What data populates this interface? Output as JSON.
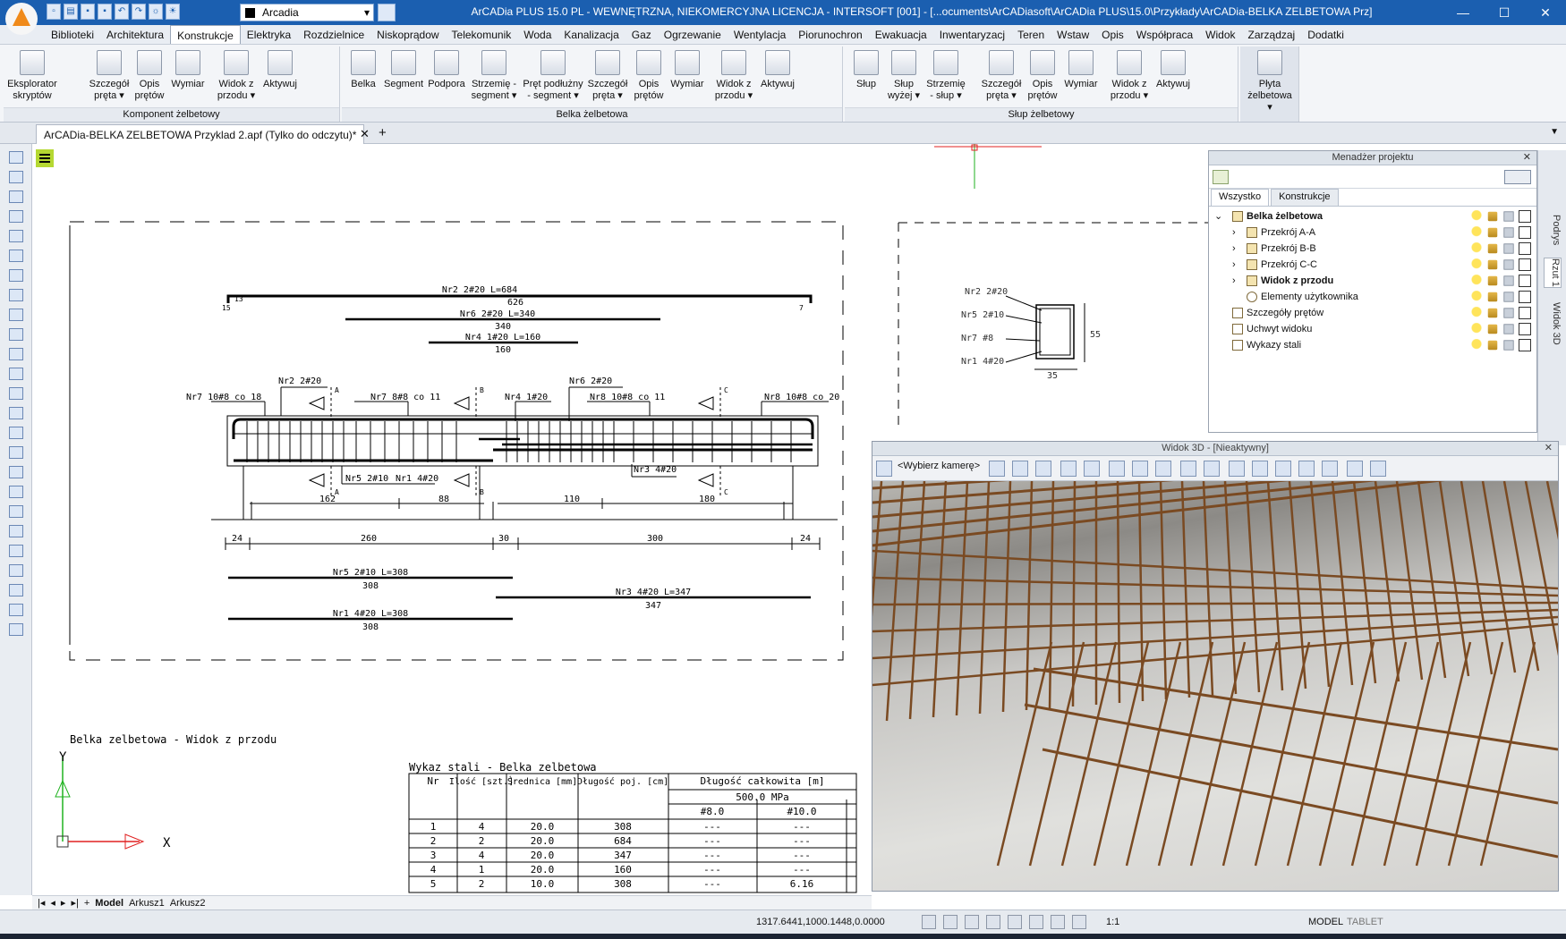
{
  "window": {
    "title": "ArCADia PLUS 15.0 PL - WEWNĘTRZNA, NIEKOMERCYJNA LICENCJA - INTERSOFT [001] - [...ocuments\\ArCADiasoft\\ArCADia PLUS\\15.0\\Przykłady\\ArCADia-BELKA ZELBETOWA Prz]",
    "layer": "Arcadia",
    "minimize": "—",
    "maximize": "☐",
    "close": "✕"
  },
  "menu": [
    "Biblioteki",
    "Architektura",
    "Konstrukcje",
    "Elektryka",
    "Rozdzielnice",
    "Niskoprądow",
    "Telekomunik",
    "Woda",
    "Kanalizacja",
    "Gaz",
    "Ogrzewanie",
    "Wentylacja",
    "Piorunochron",
    "Ewakuacja",
    "Inwentaryzacj",
    "Teren",
    "Wstaw",
    "Opis",
    "Współpraca",
    "Widok",
    "Zarządzaj",
    "Dodatki"
  ],
  "ribbon": {
    "g1": {
      "label": "Komponent żelbetowy",
      "b1": "Eksplorator skryptów",
      "b2": "Szczegół pręta ▾",
      "b3": "Opis prętów",
      "b4": "Wymiar",
      "b5": "Widok z przodu ▾",
      "b6": "Aktywuj"
    },
    "g2": {
      "label": "Belka żelbetowa",
      "b1": "Belka",
      "b2": "Segment",
      "b3": "Podpora",
      "b4": "Strzemię - segment ▾",
      "b5": "Pręt podłużny - segment ▾",
      "b6": "Szczegół pręta ▾",
      "b7": "Opis prętów",
      "b8": "Wymiar",
      "b9": "Widok z przodu ▾",
      "b10": "Aktywuj"
    },
    "g3": {
      "label": "Słup żelbetowy",
      "b1": "Słup",
      "b2": "Słup wyżej ▾",
      "b3": "Strzemię - słup ▾",
      "b4": "Szczegół pręta ▾",
      "b5": "Opis prętów",
      "b6": "Wymiar",
      "b7": "Widok z przodu ▾",
      "b8": "Aktywuj"
    },
    "g4": {
      "b1": "Płyta żelbetowa ▾"
    }
  },
  "doc": {
    "tab": "ArCADia-BELKA ZELBETOWA Przyklad 2.apf (Tylko do odczytu)*",
    "close": "✕",
    "plus": "+"
  },
  "drawing": {
    "t1a": "Nr2 2#20 L=684",
    "t1b": "626",
    "t2a": "Nr6 2#20 L=340",
    "t2b": "340",
    "t3a": "Nr4 1#20 L=160",
    "t3b": "160",
    "l1": "Nr7 10#8 co 18",
    "l2": "Nr2 2#20",
    "l3": "Nr7 8#8 co 11",
    "l4": "Nr4 1#20",
    "l5": "Nr6 2#20",
    "l6": "Nr8 10#8 co 11",
    "l7": "Nr8 10#8 co 20",
    "l8": "Nr5 2#10",
    "l9": "Nr1 4#20",
    "l10": "Nr3 4#20",
    "d1": "162",
    "d2": "88",
    "d3": "110",
    "d4": "180",
    "e1": "24",
    "e2": "260",
    "e3": "30",
    "e4": "300",
    "e5": "24",
    "b1a": "Nr5 2#10 L=308",
    "b1b": "308",
    "b2a": "Nr3 4#20 L=347",
    "b2b": "347",
    "b3a": "Nr1 4#20 L=308",
    "b3b": "308",
    "caption": "Belka zelbetowa - Widok z przodu",
    "axisY": "Y",
    "axisX": "X",
    "sect": {
      "a": "Nr2 2#20",
      "b": "Nr5 2#10",
      "c": "Nr7 #8",
      "d": "Nr1 4#20",
      "w": "35",
      "h": "55"
    },
    "marks": {
      "a": "A",
      "b": "B",
      "c": "C",
      "s5": "5",
      "s15": "15",
      "s13": "13",
      "s7": "7"
    }
  },
  "table": {
    "title": "Wykaz stali - Belka zelbetowa",
    "h1": "Nr",
    "h2": "Ilość [szt.]",
    "h3": "Średnica [mm]",
    "h4": "Długość poj. [cm]",
    "h5": "Długość całkowita [m]",
    "h6": "500.0 MPa",
    "h7": "#8.0",
    "h8": "#10.0",
    "rows": [
      [
        "1",
        "4",
        "20.0",
        "308",
        "---",
        "---"
      ],
      [
        "2",
        "2",
        "20.0",
        "684",
        "---",
        "---"
      ],
      [
        "3",
        "4",
        "20.0",
        "347",
        "---",
        "---"
      ],
      [
        "4",
        "1",
        "20.0",
        "160",
        "---",
        "---"
      ],
      [
        "5",
        "2",
        "10.0",
        "308",
        "---",
        "6.16"
      ]
    ]
  },
  "pm": {
    "title": "Menadżer projektu",
    "close": "✕",
    "tab1": "Wszystko",
    "tab2": "Konstrukcje",
    "items": [
      "Belka żelbetowa",
      "Przekrój A-A",
      "Przekrój B-B",
      "Przekrój C-C",
      "Widok z przodu",
      "Elementy użytkownika",
      "Szczegóły prętów",
      "Uchwyt widoku",
      "Wykazy stali"
    ]
  },
  "side": {
    "t1": "Podrys",
    "t2": "Rzut 1",
    "t3": "Widok 3D"
  },
  "view3d": {
    "title": "Widok 3D - [Nieaktywny]",
    "camera": "<Wybierz kamerę>",
    "close": "✕"
  },
  "status": {
    "model": "Model",
    "sheet1": "Arkusz1",
    "sheet2": "Arkusz2",
    "coords": "1317.6441,1000.1448,0.0000",
    "mode": "MODEL",
    "tablet": "TABLET",
    "scale": "1:1"
  }
}
